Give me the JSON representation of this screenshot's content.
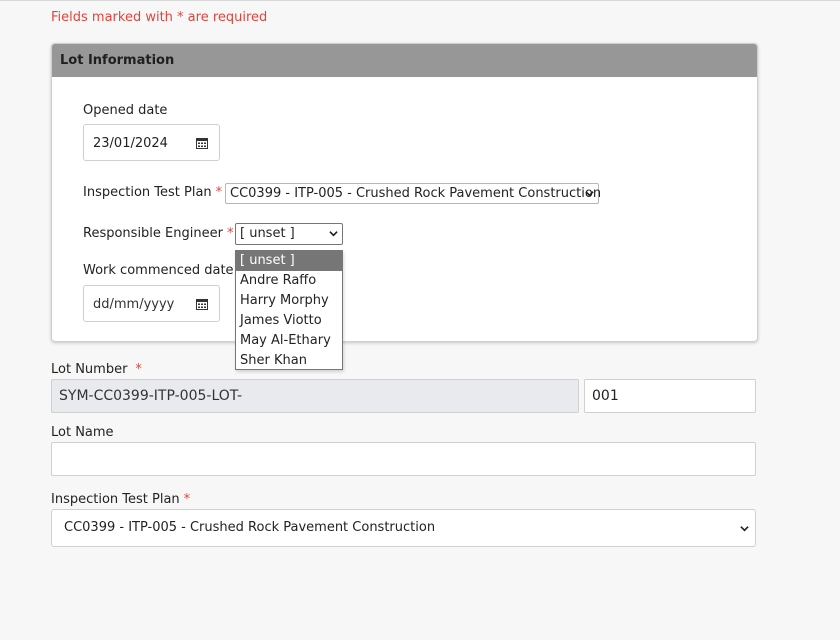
{
  "form": {
    "required_note": "Fields marked with * are required",
    "required_star": "*"
  },
  "lot_information": {
    "title": "Lot Information",
    "opened_date": {
      "label": "Opened date",
      "value": "23/01/2024"
    },
    "inspection_test_plan": {
      "label": "Inspection Test Plan",
      "value": "CC0399 - ITP-005 - Crushed Rock Pavement Construction"
    },
    "responsible_engineer": {
      "label": "Responsible Engineer",
      "value": "[ unset ]",
      "options": [
        "[ unset ]",
        "Andre Raffo",
        "Harry Morphy",
        "James Viotto",
        "May Al-Ethary",
        "Sher Khan"
      ]
    },
    "work_commenced_date": {
      "label": "Work commenced date",
      "placeholder": "dd/mm/yyyy"
    }
  },
  "lot_number": {
    "label": "Lot Number",
    "prefix": "SYM-CC0399-ITP-005-LOT-",
    "suffix": "001"
  },
  "lot_name": {
    "label": "Lot Name",
    "value": ""
  },
  "inspection_test_plan": {
    "label": "Inspection Test Plan",
    "value": "CC0399 - ITP-005 - Crushed Rock Pavement Construction"
  },
  "icons": {
    "calendar": "calendar-icon",
    "chevron": "chevron-down-icon"
  },
  "colors": {
    "required": "#e0453c",
    "header": "#979797",
    "selected_option": "#767676"
  }
}
